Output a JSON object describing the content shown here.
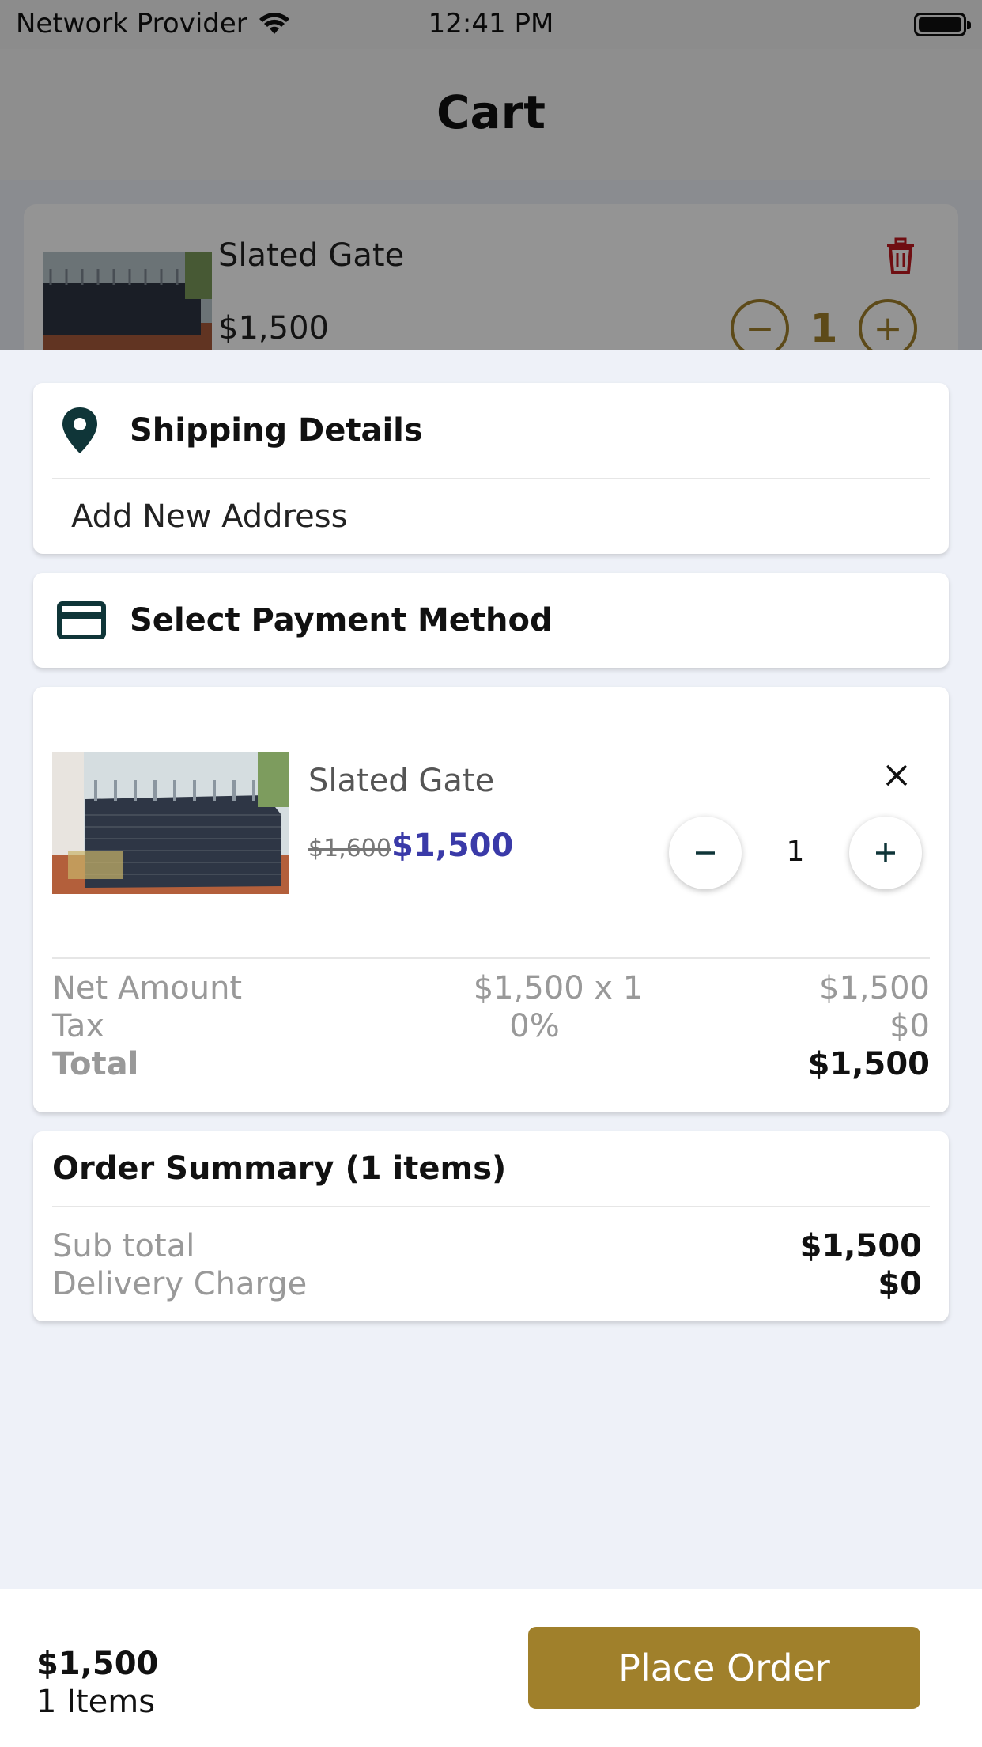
{
  "status_bar": {
    "carrier": "Network Provider",
    "time": "12:41 PM"
  },
  "background": {
    "title": "Cart",
    "item": {
      "name": "Slated Gate",
      "price": "$1,500",
      "quantity": "1"
    }
  },
  "shipping": {
    "title": "Shipping Details",
    "add_address": "Add New Address"
  },
  "payment": {
    "title": "Select Payment Method"
  },
  "item": {
    "name": "Slated Gate",
    "old_price": "$1,600",
    "price": "$1,500",
    "quantity": "1",
    "net_amount": {
      "label": "Net Amount",
      "formula": "$1,500 x 1",
      "value": "$1,500"
    },
    "tax": {
      "label": "Tax",
      "rate": "0%",
      "value": "$0"
    },
    "total": {
      "label": "Total",
      "value": "$1,500"
    }
  },
  "order_summary": {
    "title": "Order Summary (1 items)",
    "subtotal": {
      "label": "Sub total",
      "value": "$1,500"
    },
    "delivery": {
      "label": "Delivery Charge",
      "value": "$0"
    }
  },
  "bottom_bar": {
    "total": "$1,500",
    "items": "1 Items",
    "place_order": "Place Order"
  },
  "colors": {
    "accent": "#a0802b",
    "price_blue": "#3a3aa8",
    "icon_dark": "#0f3538",
    "trash_red": "#c0191f"
  }
}
